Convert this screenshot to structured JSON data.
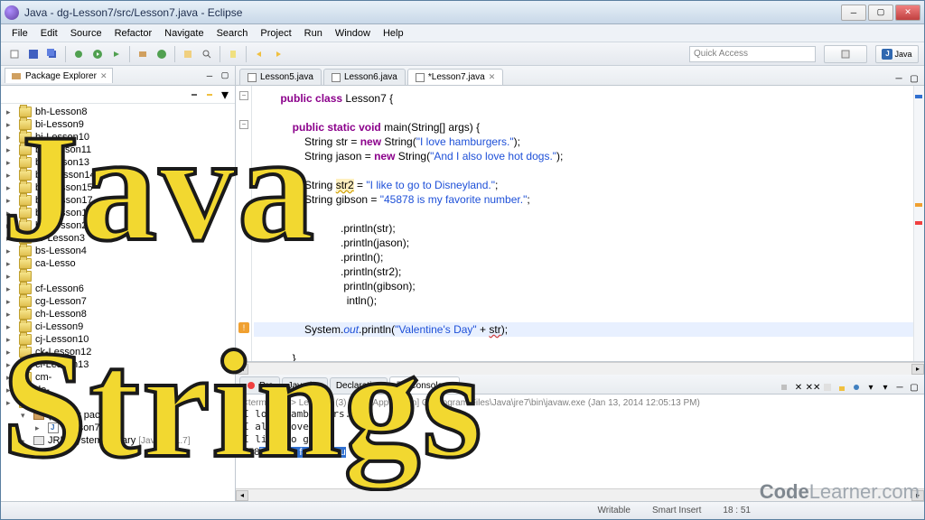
{
  "window": {
    "title": "Java - dg-Lesson7/src/Lesson7.java - Eclipse",
    "min": "─",
    "max": "▢",
    "close": "✕"
  },
  "menu": [
    "File",
    "Edit",
    "Source",
    "Refactor",
    "Navigate",
    "Search",
    "Project",
    "Run",
    "Window",
    "Help"
  ],
  "quickaccess": "Quick Access",
  "perspective": "Java",
  "packageExplorer": {
    "title": "Package Explorer"
  },
  "tree": [
    {
      "label": "bh-Lesson8",
      "indent": 0
    },
    {
      "label": "bi-Lesson9",
      "indent": 0
    },
    {
      "label": "bj-Lesson10",
      "indent": 0
    },
    {
      "label": "bk-Lesson11",
      "indent": 0
    },
    {
      "label": "bl-Lesson13",
      "indent": 0
    },
    {
      "label": "bm-Lesson14",
      "indent": 0
    },
    {
      "label": "bn-Lesson15",
      "indent": 0
    },
    {
      "label": "bo-Lesson17",
      "indent": 0
    },
    {
      "label": "bp-Lesson1",
      "indent": 0
    },
    {
      "label": "bq-Lesson2",
      "indent": 0
    },
    {
      "label": "br-Lesson3",
      "indent": 0
    },
    {
      "label": "bs-Lesson4",
      "indent": 0
    },
    {
      "label": "ca-Lesso",
      "indent": 0
    },
    {
      "label": "",
      "indent": 0
    },
    {
      "label": "cf-Lesson6",
      "indent": 0
    },
    {
      "label": "cg-Lesson7",
      "indent": 0
    },
    {
      "label": "ch-Lesson8",
      "indent": 0
    },
    {
      "label": "ci-Lesson9",
      "indent": 0
    },
    {
      "label": "cj-Lesson10",
      "indent": 0
    },
    {
      "label": "ck-Lesson12",
      "indent": 0
    },
    {
      "label": "cl-Lesson13",
      "indent": 0
    },
    {
      "label": "cm-",
      "indent": 0
    },
    {
      "label": "de-",
      "indent": 0
    },
    {
      "label": "son6",
      "indent": 0
    }
  ],
  "treeExtra": {
    "pkg": "(default package)",
    "file": "Lesson7.java",
    "lib": "JRE System Library",
    "libver": "[JavaSE-1.7]"
  },
  "editorTabs": [
    {
      "label": "Lesson5.java",
      "active": false
    },
    {
      "label": "Lesson6.java",
      "active": false
    },
    {
      "label": "*Lesson7.java",
      "active": true
    }
  ],
  "code": {
    "l1_a": "public",
    "l1_b": "class",
    "l1_c": " Lesson7 {",
    "l3_a": "public",
    "l3_b": "static",
    "l3_c": "void",
    "l3_d": " main(String[] args) {",
    "l4_a": "            String str = ",
    "l4_b": "new",
    "l4_c": " String(",
    "l4_d": "\"I love hamburgers.\"",
    "l4_e": ");",
    "l5_a": "            String jason = ",
    "l5_b": "new",
    "l5_c": " String(",
    "l5_d": "\"And I also love hot dogs.\"",
    "l5_e": ");",
    "l7_a": "            String ",
    "l7_b": "str2",
    "l7_c": " = ",
    "l7_d": "\"I like to go to Disneyland.\"",
    "l7_e": ";",
    "l8_a": "            String gibson = ",
    "l8_b": "\"45878 is my favorite number.\"",
    "l8_c": ";",
    "l10": ".println(str);",
    "l11": ".println(jason);",
    "l12": ".println();",
    "l13": ".println(str2);",
    "l14": "println(gibson);",
    "l15": "intln();",
    "l17_a": "            System.",
    "l17_b": "out",
    "l17_c": ".println(",
    "l17_d": "\"Valentine's Day\"",
    "l17_e": " + ",
    "l17_f": "str",
    "l17_g": ");",
    "l19": "        }"
  },
  "consoleTabs": [
    "Pro",
    "Javadoc",
    "Declaration",
    "Console"
  ],
  "console": {
    "header": "<terminated> Lesson7 (3) [Java Application] C:\\Program Files\\Java\\jre7\\bin\\javaw.exe (Jan 13, 2014 12:05:13 PM)",
    "out1": "I love hamburgers.",
    "out2": "I also love",
    "out3": "I like to go to",
    "out4a": "458",
    "out4b": "78 is my favorite nu"
  },
  "status": {
    "writable": "Writable",
    "insert": "Smart Insert",
    "position": "18 : 51"
  },
  "overlay": {
    "java": "Java",
    "strings": "Strings"
  },
  "watermark": {
    "a": "Code",
    "b": "Learner",
    "c": ".com"
  }
}
